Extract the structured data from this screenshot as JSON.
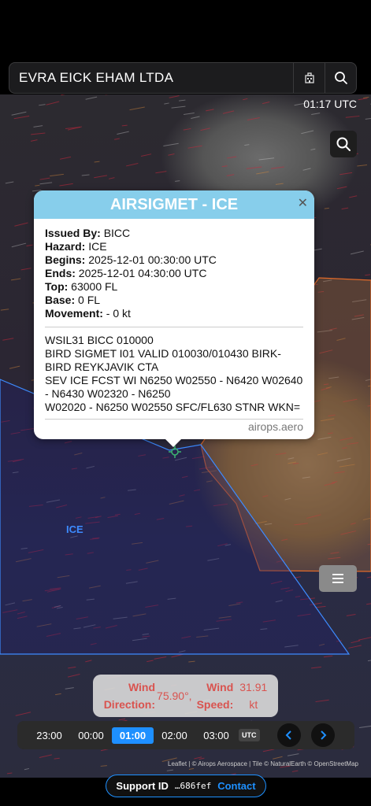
{
  "search": {
    "value": "EVRA EICK EHAM LTDA"
  },
  "header": {
    "utc_time": "01:17 UTC"
  },
  "popup": {
    "title": "AIRSIGMET - ICE",
    "fields": [
      {
        "label": "Issued By:",
        "value": "BICC"
      },
      {
        "label": "Hazard:",
        "value": "ICE"
      },
      {
        "label": "Begins:",
        "value": "2025-12-01 00:30:00 UTC"
      },
      {
        "label": "Ends:",
        "value": "2025-12-01 04:30:00 UTC"
      },
      {
        "label": "Top:",
        "value": "63000 FL"
      },
      {
        "label": "Base:",
        "value": "0 FL"
      },
      {
        "label": "Movement:",
        "value": "- 0 kt"
      }
    ],
    "raw_lines": [
      "WSIL31 BICC 010000",
      "BIRD SIGMET I01 VALID 010030/010430 BIRK-",
      "BIRD REYKJAVIK CTA",
      "SEV ICE FCST WI N6250 W02550 - N6420 W02640",
      "- N6430 W02320 - N6250",
      "W02020 - N6250 W02550 SFC/FL630 STNR WKN="
    ],
    "footer": "airops.aero"
  },
  "map": {
    "zone_label": "ICE"
  },
  "wind": {
    "direction_label_1": "Wind",
    "direction_label_2": "Direction:",
    "direction_value": "75.90°,",
    "speed_label_1": "Wind",
    "speed_label_2": "Speed:",
    "speed_value_1": "31.91",
    "speed_value_2": "kt"
  },
  "timeline": {
    "times": [
      "23:00",
      "00:00",
      "01:00",
      "02:00",
      "03:00"
    ],
    "active": "01:00",
    "utc_badge": "UTC"
  },
  "attribution": "Leaflet | © Airops Aerospace | Tile © NaturalEarth © OpenStreetMap",
  "support": {
    "label": "Support ID",
    "code": "…686fef",
    "contact": "Contact"
  },
  "colors": {
    "accent": "#1e90ff",
    "popup_header": "#87ceeb",
    "wind_text": "#d9534f",
    "zone_line": "#3d8bff",
    "zone2_line": "#e06a2a"
  }
}
